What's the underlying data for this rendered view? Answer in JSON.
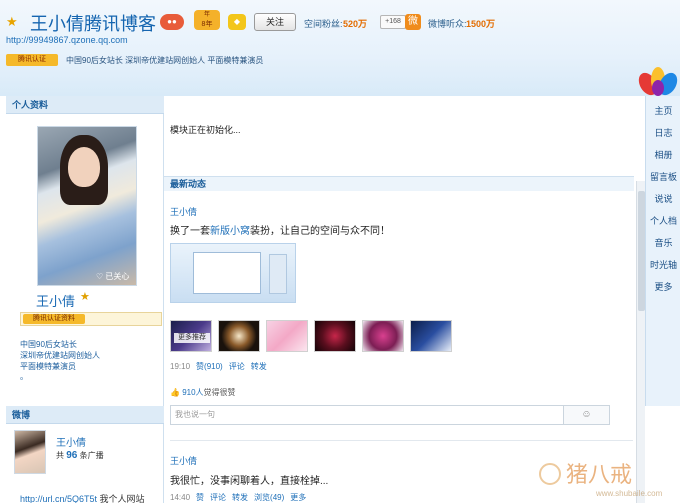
{
  "header": {
    "title": "王小倩腾讯博客",
    "url": "http://99949867.qzone.qq.com",
    "badge_year": "8年",
    "follow_label": "关注",
    "fans_label": "空间粉丝:",
    "fans_count": "520万",
    "plus_label": "+168",
    "weibo_label": "微博听众:",
    "weibo_count": "1500万",
    "verify_badge": "腾讯认证",
    "description": "中国90后女站长  深圳帝优建站网创始人  平面模特兼演员"
  },
  "nav": {
    "items": [
      "主页",
      "日志",
      "相册",
      "留言板",
      "说说",
      "个人档",
      "音乐",
      "时光轴",
      "更多"
    ]
  },
  "profile": {
    "section_title": "个人资料",
    "photo_overlay": "已关心",
    "name": "王小倩",
    "verify_label": "腾讯认证资料",
    "lines": [
      "中国90后女站长",
      "深圳帝优建站网创始人",
      "平面模特兼演员",
      "。"
    ]
  },
  "main": {
    "init_text": "模块正在初始化...",
    "feed_title": "最新动态",
    "post1": {
      "author": "王小倩",
      "text_pre": "换了一套",
      "text_link": "新版小窝",
      "text_post": "装扮，让自己的空间与众不同！",
      "more_label": "更多推荐",
      "time": "19:10",
      "like_label": "赞",
      "like_count": "(910)",
      "comment_label": "评论",
      "share_label": "转发",
      "like_summary_count": "910人",
      "like_summary_rest": "觉得很赞",
      "comment_placeholder": "我也说一句"
    },
    "post2": {
      "author": "王小倩",
      "text": "我很忙，没事闲聊着人，直接栓掉...",
      "time": "14:40",
      "like_label": "赞",
      "comment_label": "评论",
      "share_label": "转发",
      "views_label": "浏览(49)",
      "more_label": "更多"
    }
  },
  "weibo": {
    "section_title": "微博",
    "name": "王小倩",
    "count_prefix": "共",
    "count": "96",
    "count_suffix": "条广播",
    "link_url": "http://url.cn/5Q6T5t",
    "link_rest": " 我个人网站"
  },
  "watermark": {
    "text": "猪八戒",
    "url": "www.shubaile.com"
  }
}
